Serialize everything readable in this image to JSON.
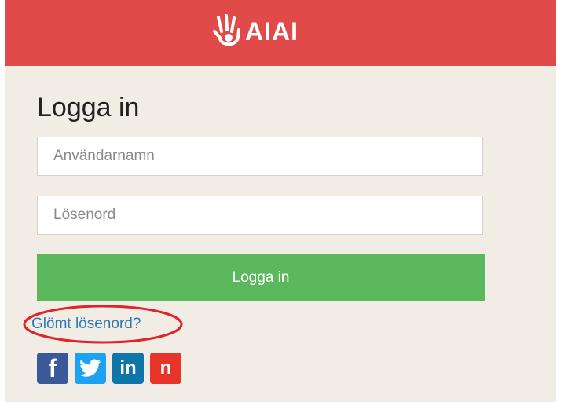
{
  "header": {
    "logo_text": "AIAI",
    "bg_color": "#e04a48"
  },
  "login": {
    "title": "Logga in",
    "username_placeholder": "Användarnamn",
    "password_placeholder": "Lösenord",
    "submit_label": "Logga in",
    "submit_color": "#5cb85c",
    "forgot_label": "Glömt lösenord?",
    "highlight_color": "#e0242a"
  },
  "social": {
    "facebook_glyph": "f",
    "linkedin_glyph": "in",
    "other_glyph": "n",
    "icons": [
      "facebook-icon",
      "twitter-icon",
      "linkedin-icon",
      "n-icon"
    ]
  }
}
